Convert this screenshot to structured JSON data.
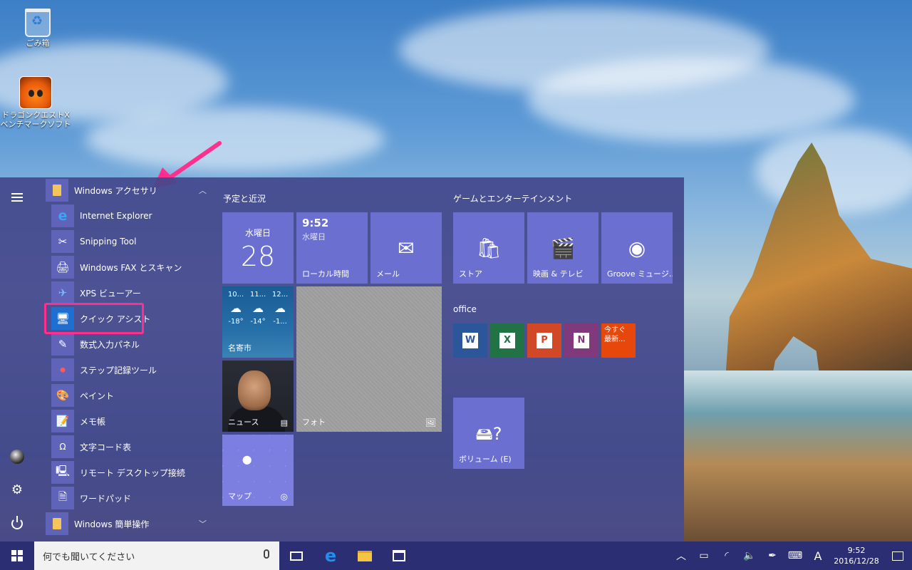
{
  "desktop": {
    "icons": [
      {
        "label": "ごみ箱"
      },
      {
        "label": "ドラゴンクエストX\nベンチマークソフト"
      }
    ]
  },
  "start_menu": {
    "folder_accessories": "Windows アクセサリ",
    "folder_ease": "Windows 簡単操作",
    "apps": [
      {
        "label": "Internet Explorer",
        "icon": "internet-explorer-icon"
      },
      {
        "label": "Snipping Tool",
        "icon": "snipping-tool-icon"
      },
      {
        "label": "Windows FAX とスキャン",
        "icon": "fax-scan-icon"
      },
      {
        "label": "XPS ビューアー",
        "icon": "xps-viewer-icon"
      },
      {
        "label": "クイック アシスト",
        "icon": "quick-assist-icon"
      },
      {
        "label": "数式入力パネル",
        "icon": "math-input-icon"
      },
      {
        "label": "ステップ記録ツール",
        "icon": "steps-recorder-icon"
      },
      {
        "label": "ペイント",
        "icon": "paint-icon"
      },
      {
        "label": "メモ帳",
        "icon": "notepad-icon"
      },
      {
        "label": "文字コード表",
        "icon": "character-map-icon"
      },
      {
        "label": "リモート デスクトップ接続",
        "icon": "remote-desktop-icon"
      },
      {
        "label": "ワードパッド",
        "icon": "wordpad-icon"
      }
    ],
    "groups": {
      "planning": "予定と近況",
      "games": "ゲームとエンターテインメント",
      "office": "office"
    },
    "tiles": {
      "calendar_day": "水曜日",
      "calendar_date": "28",
      "clock_time": "9:52",
      "clock_day": "水曜日",
      "clock_label": "ローカル時間",
      "mail_label": "メール",
      "weather_times": [
        "10...",
        "11...",
        "12..."
      ],
      "weather_temps": [
        "-18°",
        "-14°",
        "-1..."
      ],
      "weather_label": "名寄市",
      "news_label": "ニュース",
      "photo_label": "フォト",
      "map_label": "マップ",
      "store_label": "ストア",
      "movies_label": "映画 & テレビ",
      "groove_label": "Groove ミュージ...",
      "office_news": "今すぐ\n最新...",
      "volume_label": "ボリューム (E)"
    }
  },
  "taskbar": {
    "search_placeholder": "何でも聞いてください",
    "ime": "A",
    "time": "9:52",
    "date": "2016/12/28"
  },
  "colors": {
    "menu_bg": "#44488c",
    "tile": "#6b6fd0",
    "taskbar": "#2b2e72",
    "highlight": "#ff2f8f",
    "word": "#2b579a",
    "excel": "#217346",
    "powerpoint": "#d24726",
    "onenote": "#80397b",
    "office_news": "#e8470b"
  }
}
